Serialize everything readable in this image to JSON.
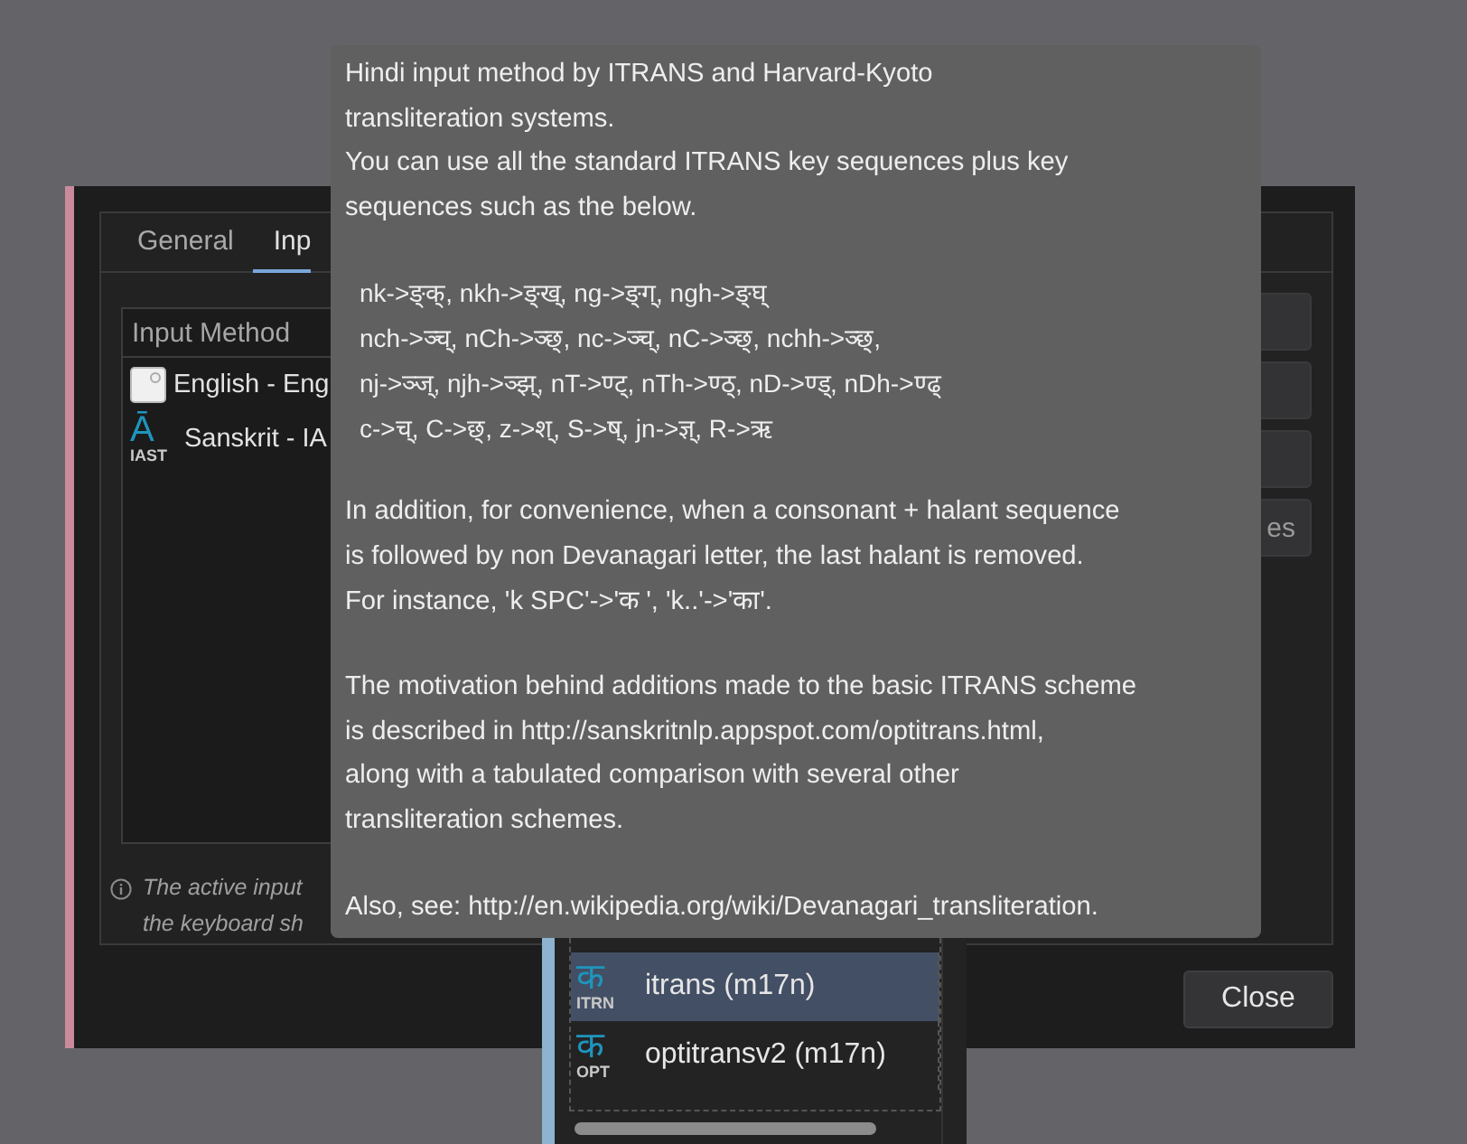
{
  "tooltip": {
    "paragraphs": [
      {
        "kind": "text",
        "lines": [
          "Hindi input method by ITRANS and Harvard-Kyoto",
          "transliteration systems.",
          "You can use all the standard ITRANS key sequences plus key",
          "sequences such as the below."
        ]
      },
      {
        "kind": "examples",
        "lines": [
          "nk->ङ्क्, nkh->ङ्ख्, ng->ङ्ग्, ngh->ङ्घ्",
          "nch->ञ्च्, nCh->ञ्छ्, nc->ञ्च्, nC->ञ्छ्, nchh->ञ्छ्,",
          "nj->ञ्ज्, njh->ञ्झ्, nT->ण्ट्, nTh->ण्ठ्, nD->ण्ड्, nDh->ण्ढ्",
          "c->च्, C->छ्, z->श्, S->ष्, jn->ज्ञ्, R->ऋ"
        ]
      },
      {
        "kind": "text",
        "lines": [
          "In addition, for convenience, when a consonant + halant sequence",
          "is followed by non Devanagari letter, the last halant is removed.",
          "For instance, 'k SPC'->'क ', 'k..'->'का'."
        ]
      },
      {
        "kind": "text",
        "lines": [
          "The motivation behind additions made to the basic ITRANS scheme",
          "is described in http://sanskritnlp.appspot.com/optitrans.html,",
          "along with a tabulated comparison with several other",
          "transliteration schemes."
        ]
      },
      {
        "kind": "text",
        "lines": [
          "Also, see: http://en.wikipedia.org/wiki/Devanagari_transliteration."
        ]
      }
    ]
  },
  "dialog": {
    "tabs": [
      {
        "label": "General",
        "selected": false
      },
      {
        "label": "Inp",
        "selected": true
      }
    ],
    "list": {
      "header": "Input Method",
      "rows": [
        {
          "name": "English - Eng",
          "icon": {
            "kind": "square"
          }
        },
        {
          "name": "Sanskrit - IA",
          "icon": {
            "kind": "glyph",
            "glyph": "Ā",
            "label": "IAST"
          }
        }
      ]
    },
    "side_buttons": [
      {
        "kind": "covered"
      },
      {
        "kind": "covered"
      },
      {
        "kind": "covered"
      },
      {
        "kind": "labeled",
        "label": "es"
      }
    ],
    "info": {
      "lines": [
        "The active input",
        "the keyboard sh"
      ]
    },
    "close_button": "Close"
  },
  "popup": {
    "items": [
      {
        "name": "itrans (m17n)",
        "selected": true,
        "icon": {
          "kind": "glyph",
          "glyph": "क",
          "label": "ITRN"
        }
      },
      {
        "name": "optitransv2 (m17n)",
        "selected": false,
        "icon": {
          "kind": "glyph",
          "glyph": "क",
          "label": "OPT"
        }
      }
    ]
  }
}
